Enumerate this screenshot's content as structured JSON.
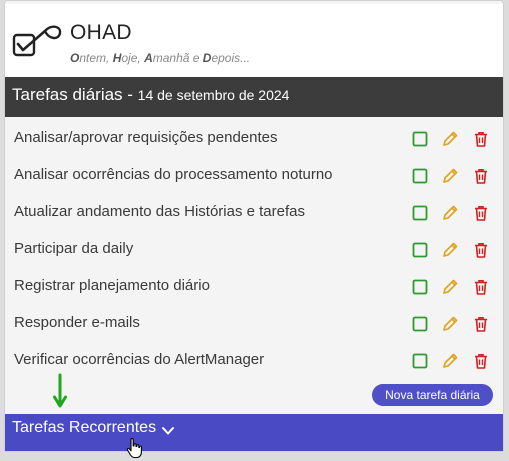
{
  "header": {
    "app_name": "OHAD",
    "tagline": [
      {
        "cap": "O",
        "rest": "ntem, "
      },
      {
        "cap": "H",
        "rest": "oje, "
      },
      {
        "cap": "A",
        "rest": "manhã e "
      },
      {
        "cap": "D",
        "rest": "epois..."
      }
    ]
  },
  "section": {
    "title": "Tarefas diárias",
    "separator": " - ",
    "date": "14 de setembro de 2024"
  },
  "tasks": [
    {
      "label": "Analisar/aprovar requisições pendentes"
    },
    {
      "label": "Analisar ocorrências do processamento noturno"
    },
    {
      "label": "Atualizar andamento das Histórias e tarefas"
    },
    {
      "label": "Participar da daily"
    },
    {
      "label": "Registrar planejamento diário"
    },
    {
      "label": "Responder e-mails"
    },
    {
      "label": "Verificar ocorrências do AlertManager"
    }
  ],
  "actions": {
    "complete_icon": "square-check-icon",
    "edit_icon": "pencil-icon",
    "delete_icon": "trash-icon"
  },
  "new_task_button": "Nova tarefa diária",
  "recurring": {
    "label": "Tarefas Recorrentes",
    "icon": "chevron-down-icon"
  },
  "colors": {
    "section_bar": "#3c3c3c",
    "accent": "#4a4ac4",
    "complete": "#2e9a2e",
    "edit": "#e0a21a",
    "delete": "#d42020",
    "annotation_arrow": "#1ea81e"
  }
}
